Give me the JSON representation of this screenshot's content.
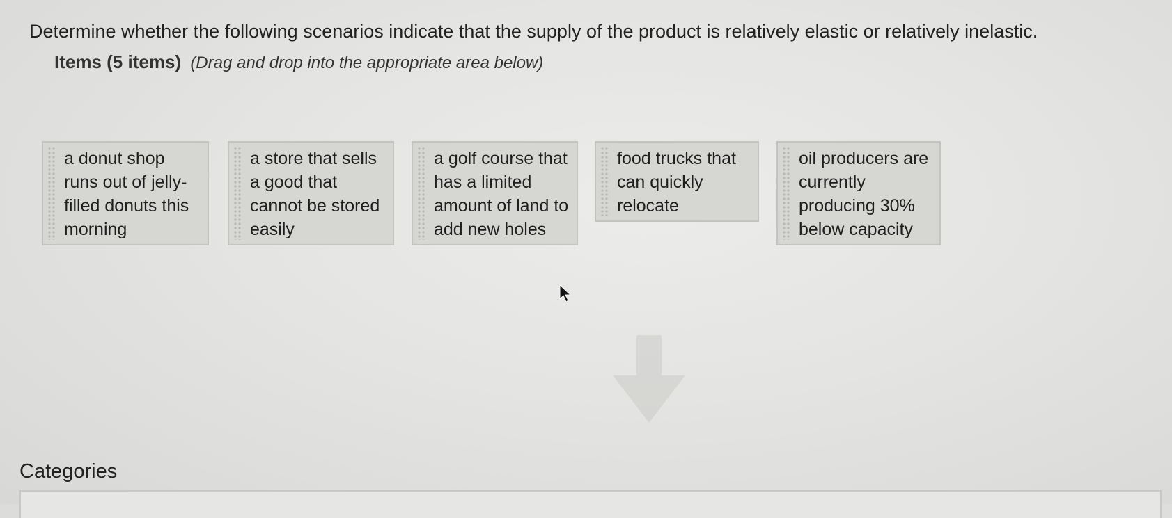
{
  "question": "Determine whether the following scenarios indicate that the supply of the product is relatively elastic or relatively inelastic.",
  "items_header": {
    "label": "Items (5 items)",
    "instruction": "(Drag and drop into the appropriate area below)"
  },
  "items": [
    {
      "text": "a donut shop runs out of jelly-filled donuts this morning"
    },
    {
      "text": "a store that sells a good that cannot be stored easily"
    },
    {
      "text": "a golf course that has a limited amount of land to add new holes"
    },
    {
      "text": "food trucks that can quickly relocate"
    },
    {
      "text": "oil producers are currently producing 30% below capacity"
    }
  ],
  "categories_title": "Categories",
  "icons": {
    "drop_hint": "down-arrow-icon",
    "pointer": "mouse-cursor-icon",
    "drag": "drag-grip-icon"
  }
}
